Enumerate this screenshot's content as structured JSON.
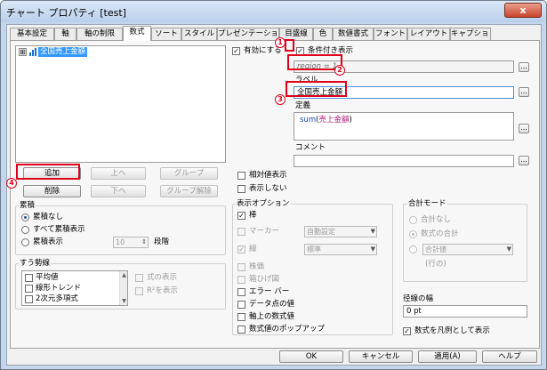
{
  "window": {
    "title": "チャート プロパティ [test]",
    "close_glyph": "x"
  },
  "tabs": [
    "基本設定",
    "軸",
    "軸の制限",
    "数式",
    "ソート",
    "スタイル",
    "プレゼンテーション",
    "目盛線",
    "色",
    "数値書式",
    "フォント",
    "レイアウト",
    "キャプション"
  ],
  "expression_list": {
    "items": [
      {
        "label": "全国売上金額",
        "expander": "⊞"
      }
    ]
  },
  "buttons": {
    "add": "追加",
    "up": "上へ",
    "group": "グループ",
    "delete": "削除",
    "down": "下へ",
    "ungroup": "グループ解除",
    "ok": "OK",
    "cancel": "キャンセル",
    "apply": "適用(A)",
    "help": "ヘルプ"
  },
  "enable": {
    "label": "有効にする",
    "checked": true
  },
  "conditional": {
    "label": "条件付き表示",
    "checked": true,
    "value": "region = 1"
  },
  "label_field": {
    "title": "ラベル",
    "value": "全国売上金額"
  },
  "definition": {
    "title": "定義",
    "func": "sum",
    "arg": "売上金額",
    "open": "(",
    "close": ")"
  },
  "comment": {
    "title": "コメント",
    "value": ""
  },
  "relative": {
    "label": "相対値表示",
    "checked": false
  },
  "invisible": {
    "label": "表示しない",
    "checked": false
  },
  "accumulation": {
    "title": "累積",
    "options": [
      "累積なし",
      "すべて累積表示",
      "累積表示"
    ],
    "selected": 0,
    "steps_value": "10",
    "steps_label": "段階"
  },
  "trendlines": {
    "title": "すう勢線",
    "items": [
      "平均値",
      "線形トレンド",
      "2次元多項式"
    ],
    "show_equation": "式の表示",
    "show_r2": "R²を表示"
  },
  "display_options": {
    "title": "表示オプション",
    "bar": "棒",
    "symbol": "マーカー",
    "symbol_value": "自動設定",
    "line": "線",
    "line_value": "標準",
    "stock": "株価",
    "box": "箱ひげ図",
    "error": "エラー バー",
    "values_on_data": "データ点の値",
    "text_on_axis": "軸上の数式値",
    "popup": "数式値のポップアップ"
  },
  "total_mode": {
    "title": "合計モード",
    "options": [
      "合計なし",
      "数式の合計",
      ""
    ],
    "selected": 1,
    "combo_value": "合計値",
    "row_label": "(行の)"
  },
  "stroke_width": {
    "title": "径線の幅",
    "value": "0 pt"
  },
  "legend": {
    "label": "数式を凡例として表示",
    "checked": true
  },
  "annotations": {
    "n1": "1",
    "n2": "2",
    "n3": "3",
    "n4": "4"
  },
  "colors": {
    "highlight": "#e0001b",
    "selection": "#3399ff",
    "func": "#1a3fc0",
    "field": "#b0187a"
  }
}
